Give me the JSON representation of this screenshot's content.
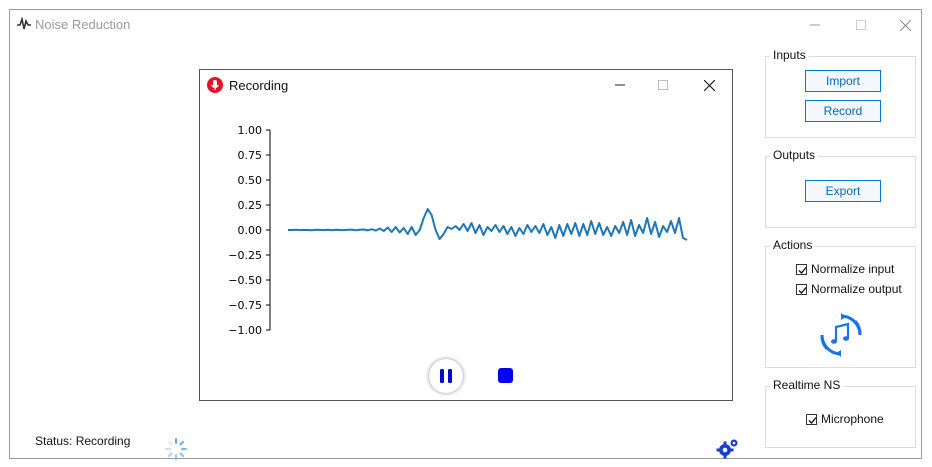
{
  "app": {
    "title": "Noise Reduction",
    "icon": "waveform-icon"
  },
  "window_controls": [
    "minimize-icon",
    "maximize-icon",
    "close-icon"
  ],
  "recording_window": {
    "title": "Recording",
    "icon": "microphone-icon",
    "controls": [
      "minimize-icon",
      "maximize-icon",
      "close-icon"
    ],
    "pause_icon": "pause-icon",
    "stop_icon": "stop-icon"
  },
  "chart_data": {
    "type": "line",
    "title": "",
    "xlabel": "",
    "ylabel": "",
    "ylim": [
      -1.0,
      1.0
    ],
    "yticks": [
      "1.00",
      "0.75",
      "0.50",
      "0.25",
      "0.00",
      "−0.25",
      "−0.50",
      "−0.75",
      "−1.00"
    ],
    "x_axis_visible": false,
    "grid": false,
    "color": "#1f77b4",
    "series": [
      {
        "values": [
          0.0,
          0.0,
          0.002,
          -0.001,
          0.001,
          0.0,
          -0.002,
          0.002,
          0.001,
          -0.001,
          0.003,
          -0.002,
          0.002,
          0.0,
          -0.001,
          0.002,
          0.004,
          -0.003,
          0.002,
          0.005,
          -0.004,
          0.008,
          -0.006,
          0.015,
          -0.01,
          0.025,
          -0.02,
          0.03,
          -0.025,
          0.02,
          -0.04,
          0.03,
          -0.05,
          0.0,
          0.12,
          0.21,
          0.15,
          0.0,
          -0.09,
          -0.04,
          0.03,
          0.01,
          0.04,
          0.0,
          0.06,
          -0.01,
          0.07,
          -0.03,
          0.05,
          -0.05,
          0.03,
          -0.01,
          0.05,
          -0.02,
          0.04,
          -0.04,
          0.03,
          -0.06,
          0.02,
          -0.04,
          0.05,
          -0.02,
          0.04,
          -0.03,
          0.06,
          -0.05,
          0.03,
          -0.08,
          0.05,
          -0.06,
          0.06,
          -0.04,
          0.07,
          -0.06,
          0.06,
          -0.05,
          0.09,
          -0.04,
          0.07,
          -0.05,
          0.03,
          -0.06,
          0.04,
          -0.03,
          0.08,
          -0.05,
          0.1,
          -0.06,
          0.05,
          -0.03,
          0.12,
          -0.04,
          0.08,
          -0.07,
          0.04,
          -0.02,
          0.09,
          -0.03,
          0.12,
          -0.08,
          -0.1
        ]
      }
    ]
  },
  "panels": {
    "inputs": {
      "label": "Inputs",
      "import_label": "Import",
      "record_label": "Record"
    },
    "outputs": {
      "label": "Outputs",
      "export_label": "Export"
    },
    "actions": {
      "label": "Actions",
      "normalize_input": "Normalize input",
      "normalize_output": "Normalize output",
      "normalize_input_checked": true,
      "normalize_output_checked": true,
      "process_icon": "music-process-icon"
    },
    "realtime": {
      "label": "Realtime NS",
      "microphone": "Microphone",
      "microphone_checked": true
    }
  },
  "status": {
    "text": "Status: Recording",
    "spinner_icon": "loading-spinner-icon"
  },
  "settings_icon": "settings-gear-icon",
  "colors": {
    "accent": "#0078d7",
    "plot_line": "#1f77b4",
    "stop": "#0000ee",
    "record_icon": "#e81123",
    "process_icon": "#1a73e8"
  }
}
